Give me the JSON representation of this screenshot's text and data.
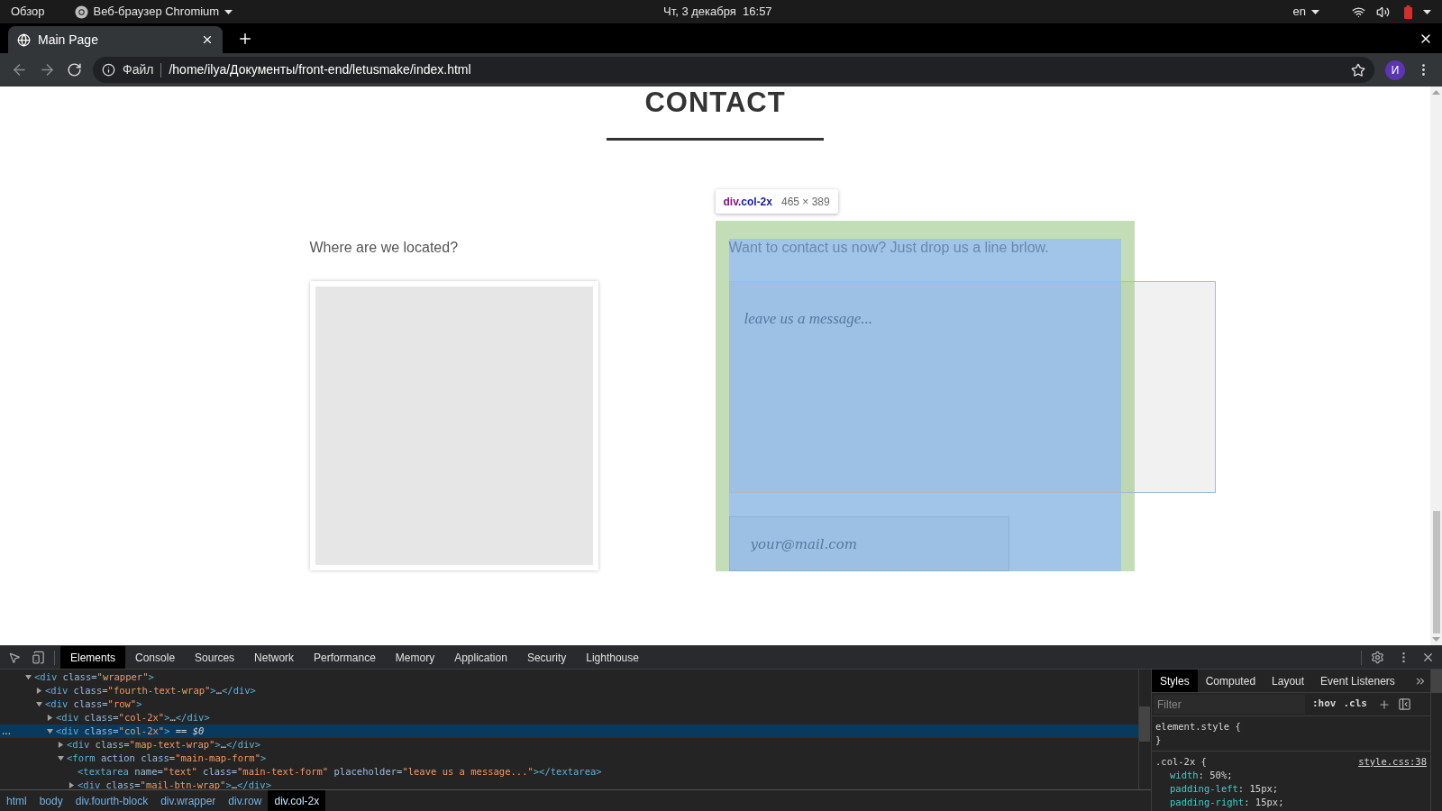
{
  "os_bar": {
    "activities": "Обзор",
    "app_name": "Веб-браузер Chromium",
    "clock": "Чт, 3 декабря  16:57",
    "language": "en"
  },
  "browser": {
    "tabs": [
      {
        "title": "Main Page",
        "selected": true
      }
    ],
    "scheme_label": "Файл",
    "url": "/home/ilya/Документы/front-end/letusmake/index.html",
    "bookmarked": false,
    "profile_initial": "И"
  },
  "page": {
    "heading": "CONTACT",
    "location_caption": "Where are we located?",
    "contact_caption": "Want to contact us now? Just drop us a line brlow.",
    "message_field": {
      "placeholder": "leave us a message..."
    },
    "email_field": {
      "placeholder": "your@mail.com"
    },
    "inspect_tooltip": {
      "tag": "div",
      "class_name": ".col-2x",
      "size": "465 × 389"
    }
  },
  "devtools": {
    "tabs": [
      {
        "label": "Elements",
        "selected": true
      },
      {
        "label": "Console",
        "selected": false
      },
      {
        "label": "Sources",
        "selected": false
      },
      {
        "label": "Network",
        "selected": false
      },
      {
        "label": "Performance",
        "selected": false
      },
      {
        "label": "Memory",
        "selected": false
      },
      {
        "label": "Application",
        "selected": false
      },
      {
        "label": "Security",
        "selected": false
      },
      {
        "label": "Lighthouse",
        "selected": false
      }
    ],
    "tree": [
      {
        "expanded": true,
        "selected": false,
        "tokens": [
          {
            "kind": "tag",
            "text": "<div"
          },
          {
            "kind": "attr",
            "text": " class="
          },
          {
            "kind": "value",
            "text": "\"wrapper\""
          },
          {
            "kind": "tag",
            "text": ">"
          }
        ],
        "children": [
          {
            "expanded": false,
            "selected": false,
            "tokens": [
              {
                "kind": "tag",
                "text": "<div"
              },
              {
                "kind": "attr",
                "text": " class="
              },
              {
                "kind": "value",
                "text": "\"fourth-text-wrap\""
              },
              {
                "kind": "tag",
                "text": ">"
              },
              {
                "kind": "plain",
                "text": "…"
              },
              {
                "kind": "tag",
                "text": "</div>"
              }
            ]
          },
          {
            "expanded": true,
            "selected": false,
            "tokens": [
              {
                "kind": "tag",
                "text": "<div"
              },
              {
                "kind": "attr",
                "text": " class="
              },
              {
                "kind": "value",
                "text": "\"row\""
              },
              {
                "kind": "tag",
                "text": ">"
              }
            ],
            "children": [
              {
                "expanded": false,
                "selected": false,
                "tokens": [
                  {
                    "kind": "tag",
                    "text": "<div"
                  },
                  {
                    "kind": "attr",
                    "text": " class="
                  },
                  {
                    "kind": "value",
                    "text": "\"col-2x\""
                  },
                  {
                    "kind": "tag",
                    "text": ">"
                  },
                  {
                    "kind": "plain",
                    "text": "…"
                  },
                  {
                    "kind": "tag",
                    "text": "</div>"
                  }
                ]
              },
              {
                "expanded": true,
                "selected": true,
                "gutter": "...",
                "tokens": [
                  {
                    "kind": "tag",
                    "text": "<div"
                  },
                  {
                    "kind": "attr",
                    "text": " class="
                  },
                  {
                    "kind": "value",
                    "text": "\"col-2x\""
                  },
                  {
                    "kind": "tag",
                    "text": ">"
                  },
                  {
                    "kind": "plain",
                    "text": " == "
                  },
                  {
                    "kind": "marker",
                    "text": "$0"
                  }
                ],
                "children": [
                  {
                    "expanded": false,
                    "selected": false,
                    "tokens": [
                      {
                        "kind": "tag",
                        "text": "<div"
                      },
                      {
                        "kind": "attr",
                        "text": " class="
                      },
                      {
                        "kind": "value",
                        "text": "\"map-text-wrap\""
                      },
                      {
                        "kind": "tag",
                        "text": ">"
                      },
                      {
                        "kind": "plain",
                        "text": "…"
                      },
                      {
                        "kind": "tag",
                        "text": "</div>"
                      }
                    ]
                  },
                  {
                    "expanded": true,
                    "selected": false,
                    "tokens": [
                      {
                        "kind": "tag",
                        "text": "<form"
                      },
                      {
                        "kind": "attr",
                        "text": " action class="
                      },
                      {
                        "kind": "value",
                        "text": "\"main-map-form\""
                      },
                      {
                        "kind": "tag",
                        "text": ">"
                      }
                    ],
                    "children": [
                      {
                        "selected": false,
                        "tokens": [
                          {
                            "kind": "tag",
                            "text": "<textarea"
                          },
                          {
                            "kind": "attr",
                            "text": " name="
                          },
                          {
                            "kind": "value",
                            "text": "\"text\""
                          },
                          {
                            "kind": "attr",
                            "text": " class="
                          },
                          {
                            "kind": "value",
                            "text": "\"main-text-form\""
                          },
                          {
                            "kind": "attr",
                            "text": " placeholder="
                          },
                          {
                            "kind": "value",
                            "text": "\"leave us a message...\""
                          },
                          {
                            "kind": "tag",
                            "text": "></textarea>"
                          }
                        ]
                      },
                      {
                        "expanded": false,
                        "selected": false,
                        "tokens": [
                          {
                            "kind": "tag",
                            "text": "<div"
                          },
                          {
                            "kind": "attr",
                            "text": " class="
                          },
                          {
                            "kind": "value",
                            "text": "\"mail-btn-wrap\""
                          },
                          {
                            "kind": "tag",
                            "text": ">"
                          },
                          {
                            "kind": "plain",
                            "text": "…"
                          },
                          {
                            "kind": "tag",
                            "text": "</div>"
                          }
                        ]
                      }
                    ]
                  }
                ]
              }
            ]
          }
        ]
      }
    ],
    "breadcrumbs": [
      {
        "label": "html",
        "selected": false
      },
      {
        "label": "body",
        "selected": false
      },
      {
        "label": "div.fourth-block",
        "selected": false
      },
      {
        "label": "div.wrapper",
        "selected": false
      },
      {
        "label": "div.row",
        "selected": false
      },
      {
        "label": "div.col-2x",
        "selected": true
      }
    ],
    "styles": {
      "tabs": [
        {
          "label": "Styles",
          "selected": true
        },
        {
          "label": "Computed",
          "selected": false
        },
        {
          "label": "Layout",
          "selected": false
        },
        {
          "label": "Event Listeners",
          "selected": false
        }
      ],
      "filter": {
        "placeholder": "Filter"
      },
      "hov": ":hov",
      "cls": ".cls",
      "rules": [
        {
          "selector": "element.style {",
          "close": "}"
        },
        {
          "selector": ".col-2x {",
          "source": "style.css:38",
          "properties": [
            {
              "name": "width",
              "separator": ": ",
              "value": "50%;"
            },
            {
              "name": "padding-left",
              "separator": ": ",
              "value": "15px;"
            },
            {
              "name": "padding-right",
              "separator": ": ",
              "value": "15px;"
            }
          ]
        }
      ]
    }
  }
}
